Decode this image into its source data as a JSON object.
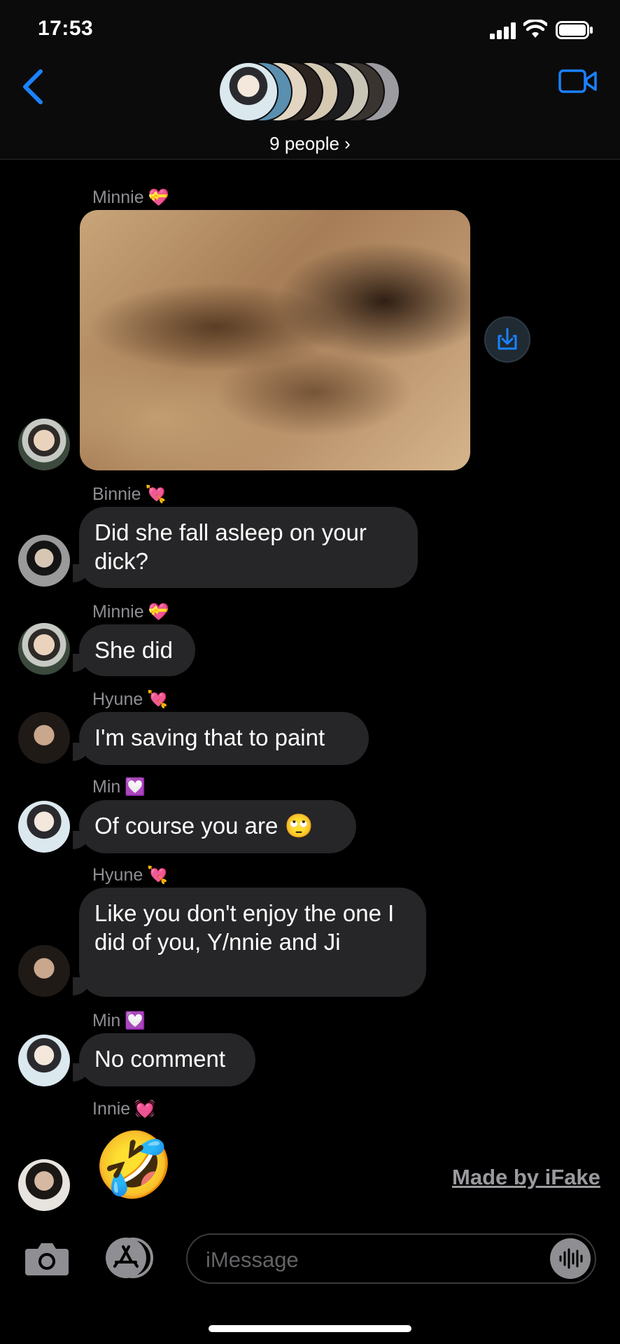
{
  "status_bar": {
    "time": "17:53"
  },
  "header": {
    "participants": "9 people ›"
  },
  "messages": [
    {
      "sender": "Minnie",
      "heart": "💝",
      "type": "photo"
    },
    {
      "sender": "Binnie",
      "heart": "💘",
      "text": "Did she fall asleep on your dick?"
    },
    {
      "sender": "Minnie",
      "heart": "💝",
      "text": "She did"
    },
    {
      "sender": "Hyune",
      "heart": "💘",
      "text": "I'm saving that to paint"
    },
    {
      "sender": "Min",
      "heart": "💟",
      "text": "Of course you are 🙄"
    },
    {
      "sender": "Hyune",
      "heart": "💘",
      "text": "Like you don't enjoy the one I did of you, Y/nnie and Ji"
    },
    {
      "sender": "Min",
      "heart": "💟",
      "text": "No comment"
    },
    {
      "sender": "Innie",
      "heart": "💓",
      "text": "🤣"
    }
  ],
  "watermark": "Made by iFake",
  "input": {
    "placeholder": "iMessage"
  },
  "icons": {
    "back": "chevron-left-icon",
    "video": "video-camera-icon",
    "save": "share-save-icon",
    "camera": "camera-icon",
    "apps": "app-store-icon",
    "audio": "waveform-icon"
  },
  "colors": {
    "accent": "#1a82ff",
    "bubble": "#262628",
    "background": "#000000"
  }
}
